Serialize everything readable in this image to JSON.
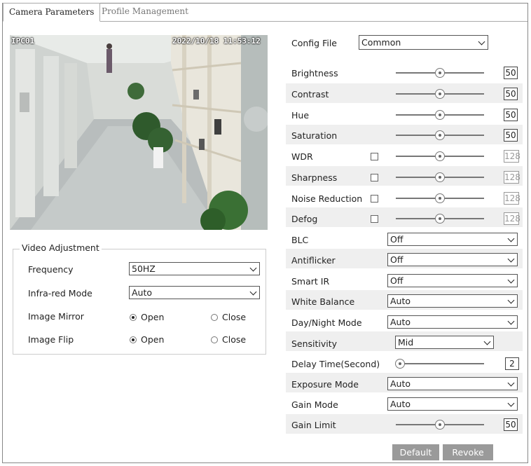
{
  "tabs": [
    "Camera Parameters",
    "Profile Management"
  ],
  "preview": {
    "channel": "IPC01",
    "timestamp": "2022/10/18 11:53:12"
  },
  "video_adjustment": {
    "title": "Video Adjustment",
    "frequency": {
      "label": "Frequency",
      "value": "50HZ"
    },
    "infrared": {
      "label": "Infra-red Mode",
      "value": "Auto"
    },
    "mirror": {
      "label": "Image Mirror",
      "open": "Open",
      "close": "Close",
      "selected": "Open"
    },
    "flip": {
      "label": "Image Flip",
      "open": "Open",
      "close": "Close",
      "selected": "Open"
    }
  },
  "config_file": {
    "label": "Config File",
    "value": "Common"
  },
  "sliders": [
    {
      "label": "Brightness",
      "value": "50",
      "level": 0.5,
      "disabled": false
    },
    {
      "label": "Contrast",
      "value": "50",
      "level": 0.5,
      "disabled": false
    },
    {
      "label": "Hue",
      "value": "50",
      "level": 0.5,
      "disabled": false
    },
    {
      "label": "Saturation",
      "value": "50",
      "level": 0.5,
      "disabled": false
    },
    {
      "label": "WDR",
      "value": "128",
      "level": 0.5,
      "disabled": true,
      "checkbox": true
    },
    {
      "label": "Sharpness",
      "value": "128",
      "level": 0.5,
      "disabled": true,
      "checkbox": true
    },
    {
      "label": "Noise Reduction",
      "value": "128",
      "level": 0.5,
      "disabled": true,
      "checkbox": true
    },
    {
      "label": "Defog",
      "value": "128",
      "level": 0.5,
      "disabled": true,
      "checkbox": true
    }
  ],
  "selects": [
    {
      "label": "BLC",
      "value": "Off"
    },
    {
      "label": "Antiflicker",
      "value": "Off"
    },
    {
      "label": "Smart IR",
      "value": "Off"
    },
    {
      "label": "White Balance",
      "value": "Auto"
    },
    {
      "label": "Day/Night Mode",
      "value": "Auto"
    }
  ],
  "sensitivity": {
    "label": "Sensitivity",
    "value": "Mid"
  },
  "delay_time": {
    "label": "Delay Time(Second)",
    "value": "2",
    "level": 0.05
  },
  "exposure_mode": {
    "label": "Exposure Mode",
    "value": "Auto"
  },
  "gain_mode": {
    "label": "Gain Mode",
    "value": "Auto"
  },
  "gain_limit": {
    "label": "Gain Limit",
    "value": "50",
    "level": 0.5
  },
  "buttons": {
    "default": "Default",
    "revoke": "Revoke"
  },
  "colors": {
    "row_stripe": "#efefef",
    "button_bg": "#9a9a9a",
    "border": "#888888"
  }
}
